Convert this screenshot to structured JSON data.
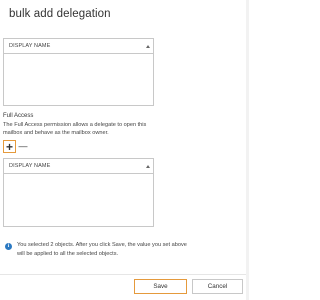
{
  "dialog": {
    "title": "bulk add delegation"
  },
  "top_list": {
    "column_header": "DISPLAY NAME"
  },
  "full_access": {
    "label": "Full Access",
    "description": "The Full Access permission allows a delegate to open this mailbox and behave as the mailbox owner.",
    "add_symbol": "+",
    "remove_symbol": "—",
    "list": {
      "column_header": "DISPLAY NAME"
    }
  },
  "info": {
    "icon": "info-icon",
    "icon_glyph": "i",
    "text": "You selected 2 objects.  After you click Save, the value you set above will be applied to all the selected objects."
  },
  "buttons": {
    "save": "Save",
    "cancel": "Cancel"
  },
  "colors": {
    "accent": "#e59a3c",
    "info": "#2b79c2",
    "border": "#c8c8c8"
  }
}
